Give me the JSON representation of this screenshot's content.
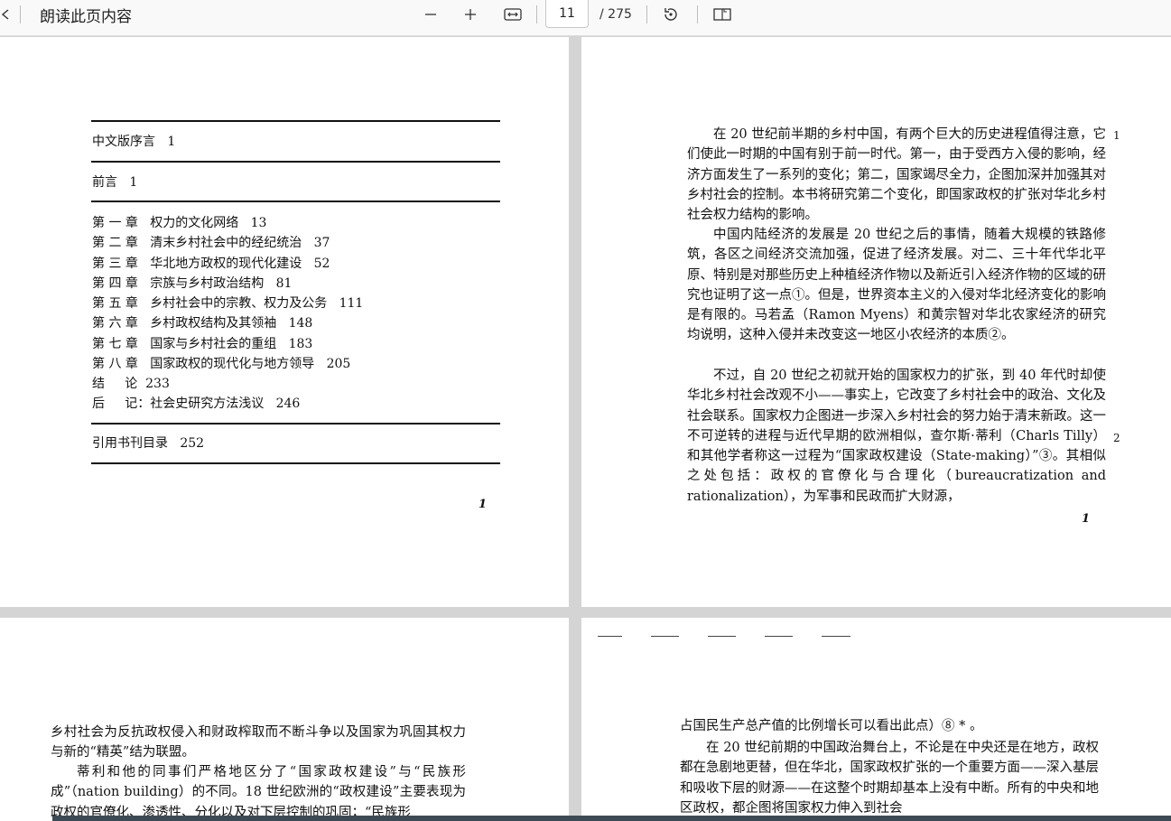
{
  "toolbar": {
    "read_aloud": "朗读此页内容",
    "page_current": "11",
    "page_total": "/ 275",
    "icons": [
      "back-icon",
      "zoom-out-icon",
      "zoom-in-icon",
      "fit-width-icon",
      "rotate-icon",
      "two-page-view-icon"
    ]
  },
  "page1": {
    "toc": {
      "preface_cn": "中文版序言   1",
      "preface": "前言   1",
      "chapters": [
        "第 一 章   权力的文化网络   13",
        "第 二 章   清末乡村社会中的经纪统治   37",
        "第 三 章   华北地方政权的现代化建设   52",
        "第 四 章   宗族与乡村政治结构   81",
        "第 五 章   乡村社会中的宗教、权力及公务   111",
        "第 六 章   乡村政权结构及其领袖   148",
        "第 七 章   国家与乡村社会的重组   183",
        "第 八 章   国家政权的现代化与地方领导   205",
        "结     论  233",
        "后     记：社会史研究方法浅议   246"
      ],
      "bibliography": "引用书刊目录   252"
    },
    "folio": "1"
  },
  "page2": {
    "paragraphs": [
      "在 20 世纪前半期的乡村中国，有两个巨大的历史进程值得注意，它们使此一时期的中国有别于前一时代。第一，由于受西方入侵的影响，经济方面发生了一系列的变化；第二，国家竭尽全力，企图加深并加强其对乡村社会的控制。本书将研究第二个变化，即国家政权的扩张对华北乡村社会权力结构的影响。",
      "中国内陆经济的发展是 20 世纪之后的事情，随着大规模的铁路修筑，各区之间经济交流加强，促进了经济发展。对二、三十年代华北平原、特别是对那些历史上种植经济作物以及新近引入经济作物的区域的研究也证明了这一点①。但是，世界资本主义的入侵对华北经济变化的影响是有限的。马若孟（Ramon Myens）和黄宗智对华北农家经济的研究均说明，这种入侵并未改变这一地区小农经济的本质②。",
      "不过，自 20 世纪之初就开始的国家权力的扩张，到 40 年代时却使华北乡村社会改观不小——事实上，它改变了乡村社会中的政治、文化及社会联系。国家权力企图进一步深入乡村社会的努力始于清末新政。这一不可逆转的进程与近代早期的欧洲相似，查尔斯·蒂利（Charls Tilly）和其他学者称这一过程为“国家政权建设（State-making）”③。其相似之处包括：政权的官僚化与合理化（bureaucratization and rationalization），为军事和民政而扩大财源，"
    ],
    "margin_numbers": [
      "1",
      "2"
    ],
    "folio": "1"
  },
  "page3": {
    "paragraphs": [
      "乡村社会为反抗政权侵入和财政榨取而不断斗争以及国家为巩固其权力与新的“精英”结为联盟。",
      "蒂利和他的同事们严格地区分了“国家政权建设”与“民族形成”（nation building）的不同。18 世纪欧洲的“政权建设”主要表现为政权的官僚化、渗透性、分化以及对下层控制的巩固；“民族形"
    ]
  },
  "page4": {
    "paragraphs": [
      "占国民生产总产值的比例增长可以看出此点）⑧ * 。",
      "在 20 世纪前期的中国政治舞台上，不论是在中央还是在地方，政权都在急剧地更替，但在华北，国家政权扩张的一个重要方面——深入基层和吸收下层的财源——在这整个时期却基本上没有中断。所有的中央和地区政权，都企图将国家权力伸入到社会"
    ]
  }
}
